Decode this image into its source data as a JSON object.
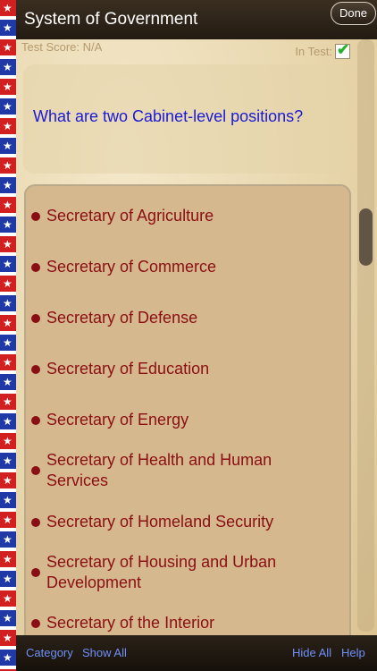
{
  "header": {
    "title": "System of Government",
    "done_label": "Done"
  },
  "status": {
    "test_score": "Test Score: N/A",
    "in_test_label": "In Test:",
    "in_test_checked": true
  },
  "question": {
    "text": "What are two Cabinet-level positions?"
  },
  "answers": [
    "Secretary of Agriculture",
    "Secretary of Commerce",
    "Secretary of Defense",
    "Secretary of Education",
    "Secretary of Energy",
    "Secretary of Health and Human Services",
    "Secretary of Homeland Security",
    "Secretary of Housing and Urban Development",
    "Secretary of the Interior"
  ],
  "toolbar": {
    "category": "Category",
    "show_all": "Show All",
    "hide_all": "Hide All",
    "help": "Help"
  },
  "colors": {
    "question": "#1a1ad8",
    "answer": "#8a0f14",
    "toolbar_link": "#6f8ff7"
  },
  "icons": {
    "check": "checkmark-icon",
    "bullet": "bullet-icon",
    "star": "star-icon"
  }
}
